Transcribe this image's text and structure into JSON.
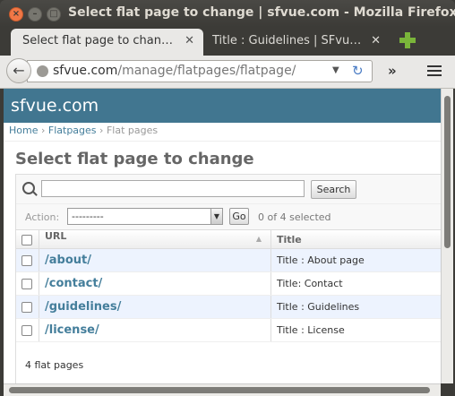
{
  "window": {
    "title": "Select flat page to change | sfvue.com - Mozilla Firefox"
  },
  "tabs": [
    {
      "label": "Select flat page to chan…",
      "close": "✕"
    },
    {
      "label": "Title : Guidelines | SFvu…",
      "close": "✕"
    }
  ],
  "nav": {
    "url_host": "sfvue.com",
    "url_path": "/manage/flatpages/flatpage/",
    "back_icon": "←",
    "reload_icon": "↻",
    "overflow_icon": "»"
  },
  "site": {
    "name": "sfvue.com"
  },
  "breadcrumbs": {
    "home": "Home",
    "section": "Flatpages",
    "current": "Flat pages",
    "sep": "›"
  },
  "page": {
    "title": "Select flat page to change"
  },
  "search": {
    "value": "",
    "button": "Search"
  },
  "actions": {
    "label": "Action:",
    "selected_option": "---------",
    "go": "Go",
    "selected_count": "0 of 4 selected"
  },
  "table": {
    "headers": {
      "url": "URL",
      "title": "Title"
    },
    "rows": [
      {
        "url": "/about/",
        "title": "Title : About page"
      },
      {
        "url": "/contact/",
        "title": "Title: Contact"
      },
      {
        "url": "/guidelines/",
        "title": "Title : Guidelines"
      },
      {
        "url": "/license/",
        "title": "Title : License"
      }
    ]
  },
  "paginator": {
    "text": "4 flat pages"
  },
  "colors": {
    "header_bg": "#417690",
    "link": "#447e9b",
    "row_alt": "#edf3fe"
  }
}
